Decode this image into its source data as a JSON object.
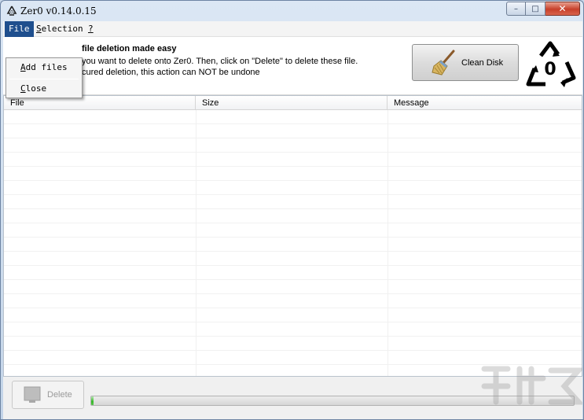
{
  "window": {
    "title": "Zer0 v0.14.0.15",
    "buttons": {
      "minimize": "–",
      "maximize": "□",
      "close": "✕"
    }
  },
  "menubar": {
    "file": {
      "prefix": "",
      "hot": "F",
      "rest": "ile"
    },
    "selection": {
      "hot": "S",
      "rest": "election"
    },
    "help": {
      "hot": "?",
      "rest": ""
    }
  },
  "file_menu": {
    "add_files": {
      "hot": "A",
      "rest": "dd files"
    },
    "close": {
      "hot": "C",
      "rest": "lose"
    }
  },
  "header": {
    "title": "file deletion made easy",
    "line1": "you want to delete onto Zer0. Then, click on \"Delete\" to delete these file.",
    "line2": "cured deletion, this action can NOT be undone",
    "clean_disk_label": "Clean Disk",
    "logo_digit": "0"
  },
  "list": {
    "columns": [
      "File",
      "Size",
      "Message"
    ],
    "rows": []
  },
  "footer": {
    "delete_label": "Delete",
    "progress_fraction": 0.005
  },
  "colors": {
    "menu_active": "#1f4f8e",
    "close_button": "#c7402a",
    "progress": "#37b72a"
  }
}
